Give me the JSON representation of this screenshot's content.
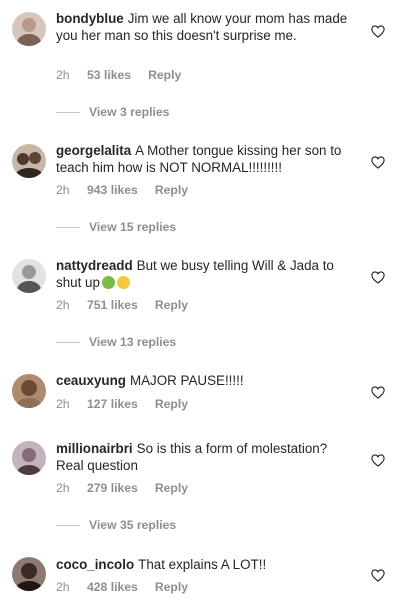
{
  "comments": [
    {
      "username": "bondyblue",
      "text": "Jim we all know your mom has made you her man so this doesn't surprise me.",
      "time": "2h",
      "likes": "53 likes",
      "reply": "Reply",
      "view_replies": "View 3 replies",
      "avatar_color": "#b89a8a"
    },
    {
      "username": "georgelalita",
      "text": "A Mother tongue kissing her son to teach him how is NOT NORMAL!!!!!!!!!",
      "time": "2h",
      "likes": "943 likes",
      "reply": "Reply",
      "view_replies": "View 15 replies",
      "avatar_color": "#4a3a30"
    },
    {
      "username": "nattydreadd",
      "text": "But we busy telling Will & Jada to shut up",
      "time": "2h",
      "likes": "751 likes",
      "reply": "Reply",
      "view_replies": "View 13 replies",
      "avatar_color": "#9a9a9a"
    },
    {
      "username": "ceauxyung",
      "text": "MAJOR PAUSE!!!!!",
      "time": "2h",
      "likes": "127 likes",
      "reply": "Reply",
      "avatar_color": "#6b4a35"
    },
    {
      "username": "millionairbri",
      "text": "So is this a form of molestation? Real question",
      "time": "2h",
      "likes": "279 likes",
      "reply": "Reply",
      "view_replies": "View 35 replies",
      "avatar_color": "#8a6a78"
    },
    {
      "username": "coco_incolo",
      "text": "That explains A LOT!!",
      "time": "2h",
      "likes": "428 likes",
      "reply": "Reply",
      "avatar_color": "#3a2a28"
    }
  ],
  "colors": {
    "text": "#262626",
    "muted": "#8e8e8e",
    "divider": "#c7c7c7"
  },
  "icons": {
    "like": "heart-outline-icon",
    "emoji_1": "nauseated-face-emoji",
    "emoji_2": "flushed-face-emoji"
  }
}
